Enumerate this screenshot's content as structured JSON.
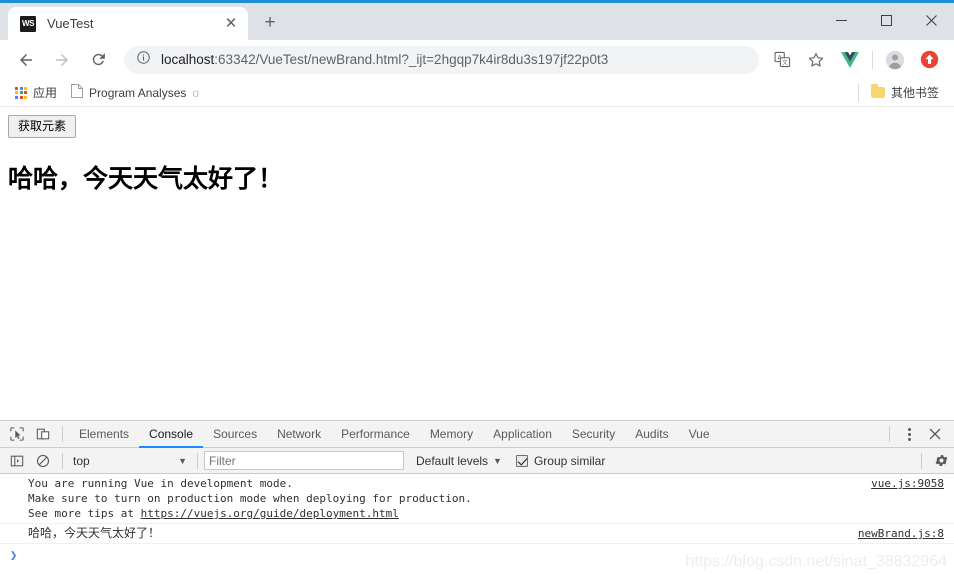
{
  "browser": {
    "tab": {
      "title": "VueTest",
      "favicon_text": "WS",
      "favicon_name": "webstorm-favicon",
      "close_label": "✕"
    },
    "new_tab_label": "+",
    "window_controls": {
      "minimize": "minimize-icon",
      "maximize": "maximize-icon",
      "close": "close-icon"
    },
    "nav": {
      "back": "back-arrow-icon",
      "forward": "forward-arrow-icon",
      "reload": "reload-icon"
    },
    "omnibox": {
      "info_icon": "info-circle-icon",
      "host": "localhost",
      "rest": ":63342/VueTest/newBrand.html?_ijt=2hgqp7k4ir8du3s197jf22p0t3",
      "full_url": "localhost:63342/VueTest/newBrand.html?_ijt=2hgqp7k4ir8du3s197jf22p0t3"
    },
    "toolbar_icons": [
      "translate-icon",
      "bookmark-star-icon",
      "vue-devtools-icon",
      "profile-avatar-icon",
      "update-arrow-icon"
    ],
    "bookmarks": {
      "apps_label": "应用",
      "items": [
        {
          "label": "Program Analyses",
          "trailing": "o"
        }
      ],
      "other_label": "其他书签"
    }
  },
  "page": {
    "button_label": "获取元素",
    "heading": "哈哈，今天天气太好了！"
  },
  "devtools": {
    "inspect_icon": "inspect-element-icon",
    "device_icon": "device-toolbar-icon",
    "tabs": [
      {
        "label": "Elements",
        "active": false
      },
      {
        "label": "Console",
        "active": true
      },
      {
        "label": "Sources",
        "active": false
      },
      {
        "label": "Network",
        "active": false
      },
      {
        "label": "Performance",
        "active": false
      },
      {
        "label": "Memory",
        "active": false
      },
      {
        "label": "Application",
        "active": false
      },
      {
        "label": "Security",
        "active": false
      },
      {
        "label": "Audits",
        "active": false
      },
      {
        "label": "Vue",
        "active": false
      }
    ],
    "more_label": "more-options-icon",
    "close_label": "✕",
    "console_toolbar": {
      "sidebar_icon": "console-sidebar-icon",
      "clear_icon": "clear-console-icon",
      "context": "top",
      "context_caret": "▼",
      "filter_placeholder": "Filter",
      "filter_value": "",
      "levels": "Default levels",
      "levels_caret": "▼",
      "group_similar": "Group similar",
      "group_similar_checked": true,
      "settings_icon": "settings-gear-icon"
    },
    "messages": [
      {
        "lines": [
          "You are running Vue in development mode.",
          "Make sure to turn on production mode when deploying for production.",
          "See more tips at "
        ],
        "link": "https://vuejs.org/guide/deployment.html",
        "source": "vue.js:9058",
        "cjk": false
      },
      {
        "lines": [
          "哈哈，今天天气太好了！"
        ],
        "link": "",
        "source": "newBrand.js:8",
        "cjk": true
      }
    ],
    "prompt_arrow": "❯",
    "watermark": "https://blog.csdn.net/sinat_38832964"
  },
  "colors": {
    "accent_blue": "#1e8fd5",
    "tabstrip_bg": "#dee1e6",
    "omnibox_bg": "#f1f3f4",
    "devtools_active": "#1a8cff",
    "vue_green": "#41b883",
    "vue_dark": "#35495e",
    "update_red": "#ea4335"
  }
}
